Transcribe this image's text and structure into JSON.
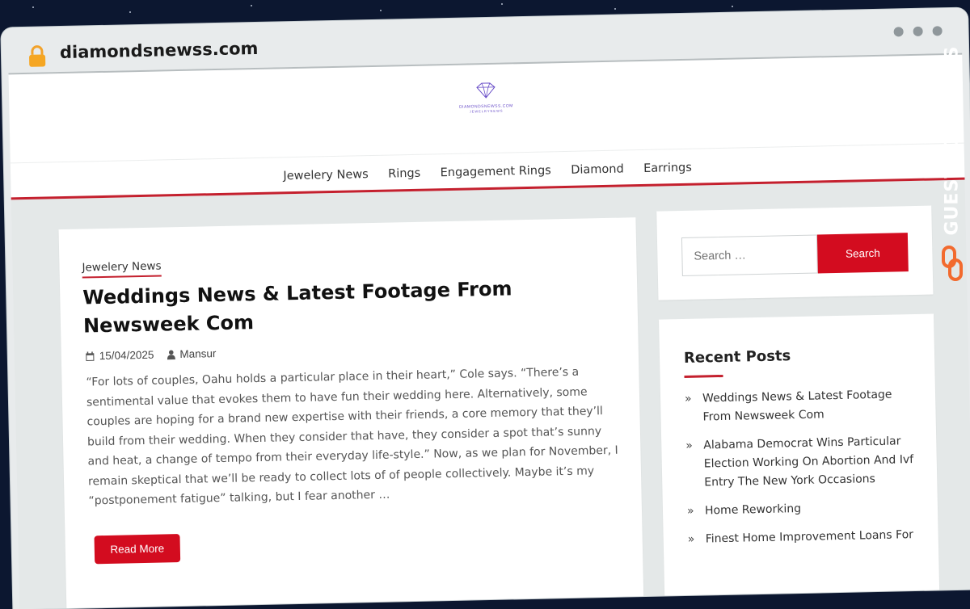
{
  "browser": {
    "url": "diamondsnewss.com"
  },
  "site": {
    "logo_text_line1": "DIAMONDSNEWSS.COM",
    "logo_text_line2": "JEWELRYNEWS",
    "nav": [
      "Jewelery News",
      "Rings",
      "Engagement Rings",
      "Diamond",
      "Earrings"
    ]
  },
  "article": {
    "category": "Jewelery News",
    "title": "Weddings News & Latest Footage From Newsweek Com",
    "date": "15/04/2025",
    "author": "Mansur",
    "excerpt": "“For lots of couples, Oahu holds a particular place in their heart,” Cole says. “There’s a sentimental value that evokes them to have fun their wedding here. Alternatively, some couples are hoping for a brand new expertise with their friends, a core memory that they’ll build from their wedding. When they consider that have, they consider a spot that’s sunny and heat, a change of tempo from their everyday life-style.” Now, as we plan for November, I remain skeptical that we’ll be ready to collect lots of of people collectively. Maybe it’s my “postponement fatigue” talking, but I fear another …",
    "read_more": "Read More"
  },
  "sidebar": {
    "search_placeholder": "Search …",
    "search_button": "Search",
    "recent_title": "Recent Posts",
    "recent_posts": [
      "Weddings News & Latest Footage From Newsweek Com",
      "Alabama Democrat Wins Particular Election Working On Abortion And Ivf Entry The New York Occasions",
      "Home Reworking",
      "Finest Home Improvement Loans For"
    ]
  },
  "watermark": {
    "text": "GUESTPOSTLINKS"
  },
  "colors": {
    "accent": "#d30c1f",
    "background": "#0c1730"
  }
}
